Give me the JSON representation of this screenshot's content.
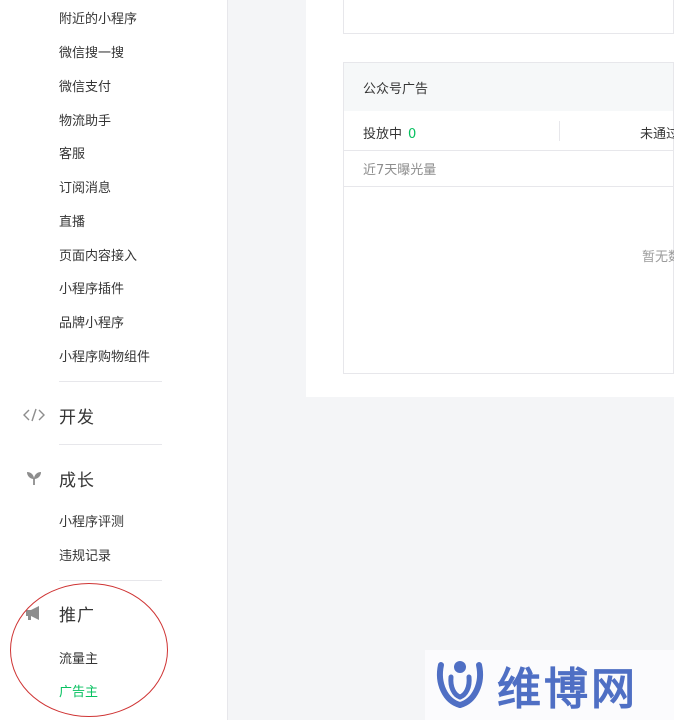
{
  "sidebar": {
    "items_top": [
      "附近的小程序",
      "微信搜一搜",
      "微信支付",
      "物流助手",
      "客服",
      "订阅消息",
      "直播",
      "页面内容接入",
      "小程序插件",
      "品牌小程序",
      "小程序购物组件"
    ],
    "dev": {
      "icon": "code-icon",
      "label": "开发"
    },
    "growth": {
      "icon": "sprout-icon",
      "label": "成长",
      "items": [
        "小程序评测",
        "违规记录"
      ]
    },
    "promo": {
      "icon": "megaphone-icon",
      "label": "推广",
      "items": [
        "流量主",
        "广告主"
      ],
      "active": "广告主"
    }
  },
  "ad_card": {
    "title": "公众号广告",
    "running_label": "投放中",
    "running_count": "0",
    "not_passed_label": "未通过",
    "exposure_label": "近7天曝光量",
    "empty_text": "暂无数"
  },
  "watermark": {
    "text": "维博网",
    "icon": "wifi-logo-icon"
  },
  "colors": {
    "accent": "#07c160",
    "annotation": "#cf3434",
    "watermark": "#4f6fc4"
  }
}
